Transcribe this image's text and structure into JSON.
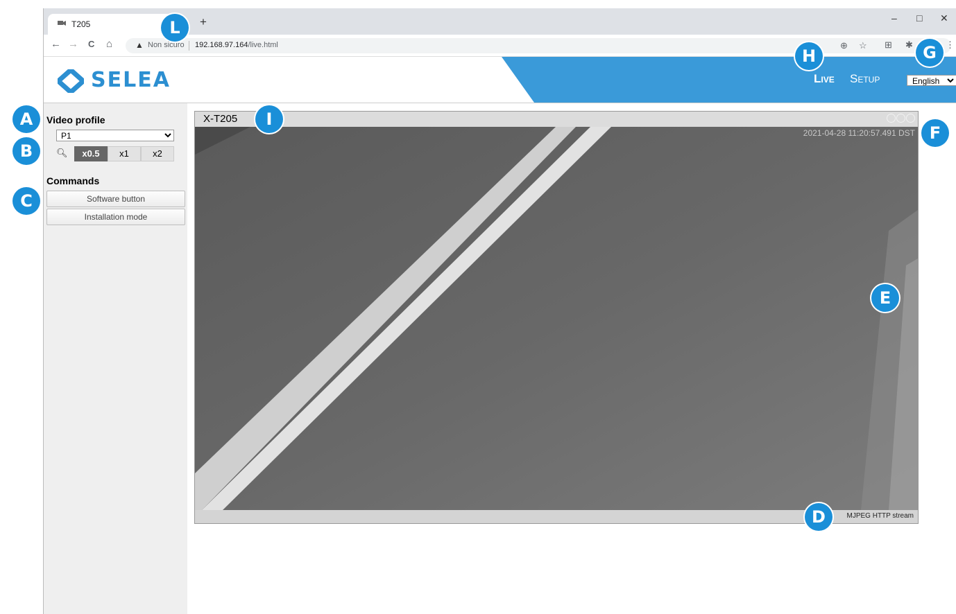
{
  "browser": {
    "tab_title": "T205",
    "new_tab": "+",
    "win_min": "–",
    "win_max": "□",
    "win_close": "✕",
    "nav": {
      "back": "←",
      "forward": "→",
      "reload": "C",
      "home": "⌂"
    },
    "security_warning": "Non sicuro",
    "url_host": "192.168.97.164",
    "url_path": "/live.html",
    "toolbar_icons": [
      "zoom-icon",
      "star-icon",
      "apps-icon",
      "extensions-icon",
      "menu-icon"
    ]
  },
  "site": {
    "logo_text": "SELEA",
    "nav_live": "Live",
    "nav_setup": "Setup",
    "language_selected": "English",
    "accent_color": "#3a9ad9"
  },
  "sidebar": {
    "video_profile_label": "Video profile",
    "profile_selected": "P1",
    "zoom_options": [
      "x0.5",
      "x1",
      "x2"
    ],
    "zoom_active": "x0.5",
    "commands_label": "Commands",
    "commands": [
      "Software button",
      "Installation mode"
    ]
  },
  "video": {
    "camera_name": "X-T205",
    "timestamp": "2021-04-28 11:20:57.491 DST",
    "stream_type": "MJPEG HTTP stream"
  },
  "callouts": {
    "A": "A",
    "B": "B",
    "C": "C",
    "D": "D",
    "E": "E",
    "F": "F",
    "G": "G",
    "H": "H",
    "I": "I",
    "L": "L"
  }
}
